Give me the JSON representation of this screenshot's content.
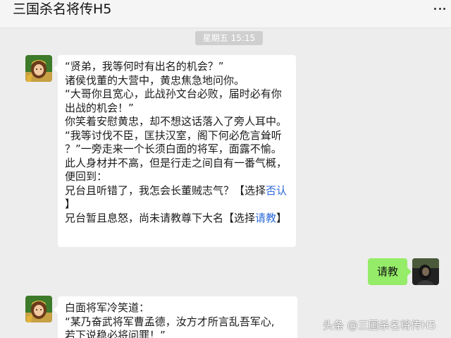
{
  "header": {
    "title": "三国杀名将传H5",
    "more_icon": "more-dots-icon"
  },
  "timestamp": "星期五  15:15",
  "messages": [
    {
      "side": "left",
      "avatar_icon": "character-avatar-icon",
      "lines": [
        "“贤弟，我等何时有出名的机会？”",
        "诸侯伐董的大营中，黄忠焦急地问你。",
        "“大哥你且宽心，此战孙文台必败，届时必有你",
        "出战的机会！”",
        "你笑着安慰黄忠，却不想这话落入了旁人耳中。",
        "“我等讨伐不臣，匡扶汉室，阁下何必危言耸听",
        "？”一旁走来一个长须白面的将军，面露不愉。",
        "此人身材并不高，但是行走之间自有一番气概，",
        "便回到："
      ],
      "choice1": {
        "prefix": "兄台且听错了，我怎会长董贼志气？【选择",
        "option": "否认",
        "suffix": "】"
      },
      "choice2": {
        "prefix": "兄台暂且息怒，尚未请教尊下大名【选择",
        "option": "请教",
        "suffix": "】"
      }
    },
    {
      "side": "right",
      "avatar_icon": "user-avatar-icon",
      "text": "请教"
    },
    {
      "side": "left",
      "avatar_icon": "character-avatar-icon",
      "lines": [
        "白面将军冷笑道：",
        "“某乃奋武将军曹孟德，汝方才所言乱吾军心,",
        "若下说稳必将问罪！”"
      ]
    }
  ],
  "watermark": "头条 @三国杀名将传H5",
  "colors": {
    "background": "#ededed",
    "bubble_left": "#ffffff",
    "bubble_right": "#95ec69",
    "choice_link": "#2b6ad9",
    "time_pill": "#cfcfcf"
  }
}
